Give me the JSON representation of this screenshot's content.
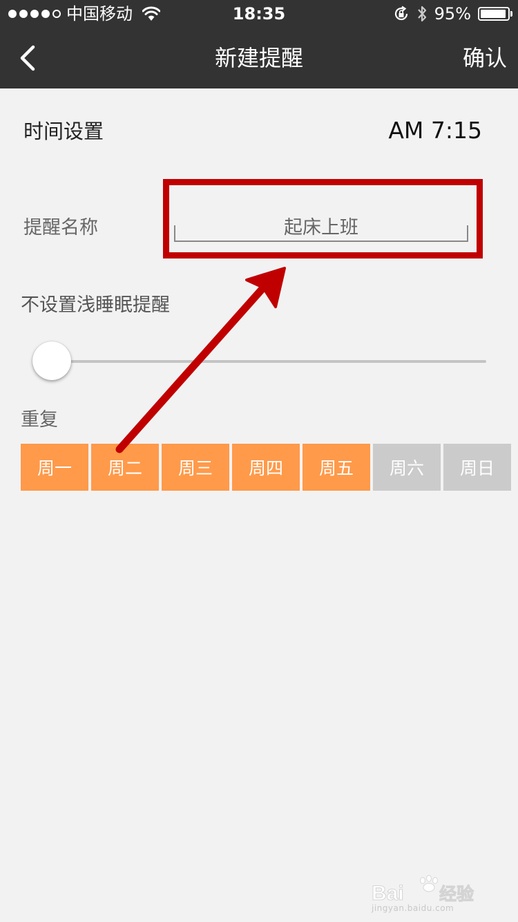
{
  "status_bar": {
    "carrier": "中国移动",
    "time": "18:35",
    "battery_percent": "95%",
    "battery_level": 0.95,
    "signal_dots": 5,
    "signal_filled": 4,
    "icons": [
      "wifi-icon",
      "rotation-lock-icon",
      "bluetooth-icon",
      "battery-icon"
    ]
  },
  "nav": {
    "title": "新建提醒",
    "confirm_label": "确认",
    "back_icon": "chevron-left-icon"
  },
  "form": {
    "time_label": "时间设置",
    "time_value": "AM 7:15",
    "name_label": "提醒名称",
    "name_value": "起床上班",
    "sleep_label": "不设置浅睡眠提醒",
    "sleep_slider_value": 0,
    "repeat_label": "重复",
    "days": [
      {
        "label": "周一",
        "selected": true
      },
      {
        "label": "周二",
        "selected": true
      },
      {
        "label": "周三",
        "selected": true
      },
      {
        "label": "周四",
        "selected": true
      },
      {
        "label": "周五",
        "selected": true
      },
      {
        "label": "周六",
        "selected": false
      },
      {
        "label": "周日",
        "selected": false
      }
    ]
  },
  "colors": {
    "bar_bg": "#333333",
    "page_bg": "#f2f2f2",
    "day_selected": "#ff9a4a",
    "day_unselected": "#cbcbcb",
    "annotation": "#c00000"
  },
  "watermark": {
    "brand": "Bai经验",
    "url": "jingyan.baidu.com"
  }
}
